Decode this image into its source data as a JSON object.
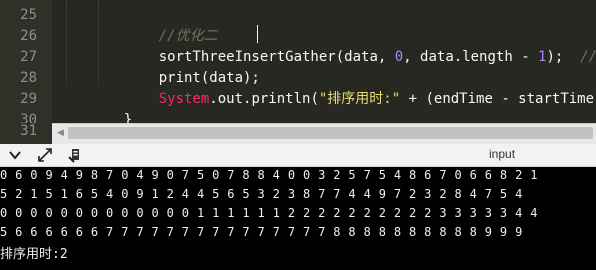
{
  "editor": {
    "lines": [
      {
        "number": "25",
        "comment": "//优化二"
      },
      {
        "number": "26",
        "method": "sortThreeInsertGather",
        "open": "(data, ",
        "zero": "0",
        "mid": ", data.length - ",
        "one": "1",
        "close": ");  ",
        "trail_comment": "//推"
      },
      {
        "number": "27",
        "text": "print(data);"
      },
      {
        "number": "28",
        "system": "System",
        "dot_out": ".out.println(",
        "str": "\"排序用时:\"",
        "rest": " + (endTime - startTime)"
      },
      {
        "number": "29",
        "text": "}"
      },
      {
        "number": "30",
        "text": ""
      },
      {
        "number": "31",
        "text": ""
      }
    ],
    "scroll_left_arrow": "◀"
  },
  "toolbar": {
    "title": "input",
    "icons": [
      "chevron-down-icon",
      "expand-icon",
      "clear-console-icon"
    ]
  },
  "console": {
    "output_lines": [
      "0 6 0 9 4 9 8 7 0 4 9 0 7 5 0 7 8 8 4 0 0 3 2 5 7 5 4 8 6 7 0 6 6 8 2 1",
      "5 2 1 5 1 6 5 4 0 9 1 2 4 4 5 6 5 3 2 3 8 7 7 4 4 9 7 2 3 2 8 4 7 5 4",
      "0 0 0 0 0 0 0 0 0 0 0 0 0 1 1 1 1 1 1 2 2 2 2 2 2 2 2 2 2 3 3 3 3 3 4 4",
      "5 6 6 6 6 6 6 7 7 7 7 7 7 7 7 7 7 7 7 7 7 7 8 8 8 8 8 8 8 8 8 8 9 9 9"
    ],
    "status": "排序用时:2"
  }
}
